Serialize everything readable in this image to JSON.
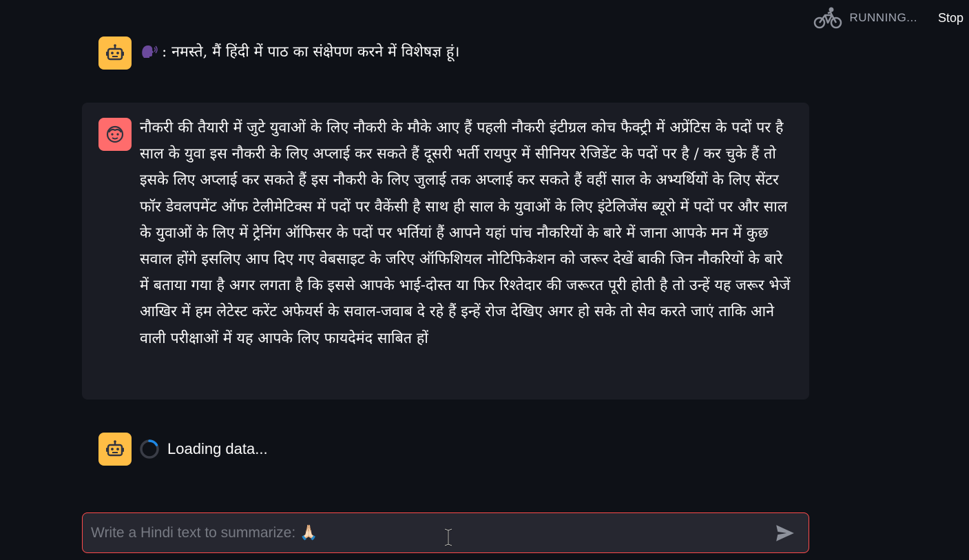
{
  "status": {
    "running_label": "RUNNING...",
    "stop_label": "Stop",
    "icon": "bicycle-icon"
  },
  "messages": [
    {
      "role": "assistant",
      "avatar_icon": "robot-icon",
      "emoji": "speaking-head-icon",
      "text": ": नमस्ते, मैं हिंदी में पाठ का संक्षेपण करने में विशेषज्ञ हूं।"
    },
    {
      "role": "user",
      "avatar_icon": "smiley-face-icon",
      "text": "नौकरी की तैयारी में जुटे युवाओं के लिए नौकरी के मौके आए हैं पहली नौकरी इंटीग्रल कोच फैक्ट्री में अप्रेंटिस के पदों पर है साल के युवा इस नौकरी के लिए अप्लाई कर सकते हैं दूसरी भर्ती रायपुर में सीनियर रेजिडेंट के पदों पर है / कर चुके हैं तो इसके लिए अप्लाई कर सकते हैं इस नौकरी के लिए जुलाई तक अप्लाई कर सकते हैं वहीं साल के अभ्यर्थियों के लिए सेंटर फॉर डेवलपमेंट ऑफ टेलीमेटिक्स में पदों पर वैकेंसी है साथ ही साल के युवाओं के लिए इंटेलिजेंस ब्यूरो में पदों पर और साल के युवाओं के लिए में ट्रेनिंग ऑफिसर के पदों पर भर्तियां हैं आपने यहां पांच नौकरियों के बारे में जाना आपके मन में कुछ सवाल होंगे इसलिए आप दिए गए वेबसाइट के जरिए ऑफिशियल नोटिफिकेशन को जरूर देखें बाकी जिन नौकरियों के बारे में बताया गया है अगर लगता है कि इससे आपके भाई-दोस्त या फिर रिश्तेदार की जरूरत पूरी होती है तो उन्हें यह जरूर भेजें आखिर में हम लेटेस्ट करेंट अफेयर्स के सवाल-जवाब दे रहे हैं इन्हें रोज देखिए अगर हो सके तो सेव करते जाएं ताकि आने वाली परीक्षाओं में यह आपके लिए फायदेमंद साबित हों"
    },
    {
      "role": "assistant",
      "avatar_icon": "robot-icon",
      "text": "Loading data..."
    }
  ],
  "input": {
    "placeholder": "Write a Hindi text to summarize: 🙏🏻",
    "value": ""
  },
  "colors": {
    "background": "#0e1117",
    "bot_avatar": "#ffbd45",
    "user_avatar": "#ff6c6c",
    "accent": "#ff4b4b",
    "spinner": "#1e88e5"
  }
}
